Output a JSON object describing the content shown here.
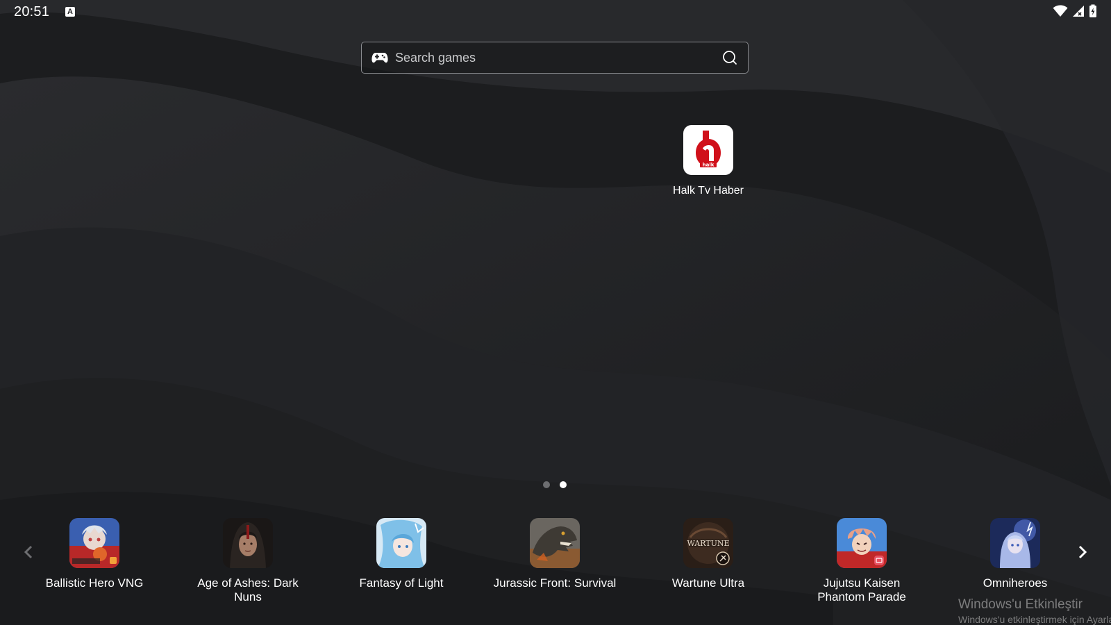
{
  "status_bar": {
    "time": "20:51",
    "keyboard_indicator": "A",
    "icons": [
      "wifi-icon",
      "cell-signal-icon",
      "battery-charging-icon"
    ]
  },
  "search": {
    "placeholder": "Search games",
    "value": ""
  },
  "desktop_apps": [
    {
      "label": "Halk Tv Haber",
      "icon": "halk-tv-logo",
      "icon_text": "halk"
    }
  ],
  "pager": {
    "pages": 2,
    "current_page": 2
  },
  "dock": {
    "apps": [
      {
        "label": "Ballistic Hero VNG",
        "icon": "ballistic-hero-icon"
      },
      {
        "label": "Age of Ashes: Dark Nuns",
        "icon": "age-of-ashes-icon"
      },
      {
        "label": "Fantasy of Light",
        "icon": "fantasy-of-light-icon"
      },
      {
        "label": "Jurassic Front: Survival",
        "icon": "jurassic-front-icon"
      },
      {
        "label": "Wartune Ultra",
        "icon": "wartune-ultra-icon"
      },
      {
        "label": "Jujutsu Kaisen Phantom Parade",
        "icon": "jujutsu-kaisen-icon"
      },
      {
        "label": "Omniheroes",
        "icon": "omniheroes-icon"
      }
    ]
  },
  "watermark": {
    "title": "Windows'u Etkinleştir",
    "subtitle": "Windows'u etkinleştirmek için Ayarlar'a gidin."
  },
  "colors": {
    "background": "#1e1f21",
    "halk_red": "#d0101a",
    "dot_inactive": "#6d6e71",
    "dot_active": "#ffffff"
  }
}
